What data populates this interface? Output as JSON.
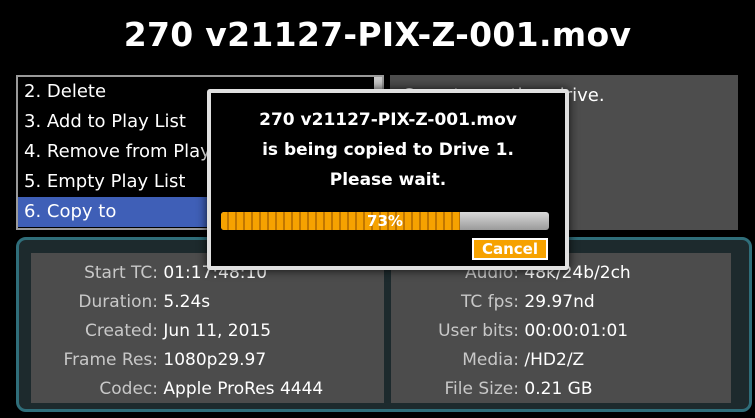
{
  "title": "270 v21127-PIX-Z-001.mov",
  "menu": {
    "items": [
      {
        "label": "2. Delete",
        "selected": false
      },
      {
        "label": "3. Add to Play List",
        "selected": false
      },
      {
        "label": "4. Remove from Play List",
        "selected": false
      },
      {
        "label": "5. Empty Play List",
        "selected": false
      },
      {
        "label": "6. Copy to",
        "selected": true
      }
    ]
  },
  "description": "Copy to another drive.",
  "info": {
    "left": [
      {
        "label": "Start TC:",
        "value": "01:17:48:10"
      },
      {
        "label": "Duration:",
        "value": "5.24s"
      },
      {
        "label": "Created:",
        "value": "Jun 11, 2015"
      },
      {
        "label": "Frame Res:",
        "value": "1080p29.97"
      },
      {
        "label": "Codec:",
        "value": "Apple ProRes 4444"
      }
    ],
    "right": [
      {
        "label": "Audio:",
        "value": "48k/24b/2ch"
      },
      {
        "label": "TC fps:",
        "value": "29.97nd"
      },
      {
        "label": "User bits:",
        "value": "00:00:01:01"
      },
      {
        "label": "Media:",
        "value": "/HD2/Z"
      },
      {
        "label": "File Size:",
        "value": "0.21 GB"
      }
    ]
  },
  "dialog": {
    "line1": "270 v21127-PIX-Z-001.mov",
    "line2": "is being copied to Drive 1.",
    "line3": "Please wait.",
    "progress_percent": 73,
    "progress_label": "73%",
    "cancel_label": "Cancel"
  },
  "colors": {
    "selection": "#3f5fb7",
    "progress": "#f6a200",
    "frame": "#2f6e7a"
  }
}
